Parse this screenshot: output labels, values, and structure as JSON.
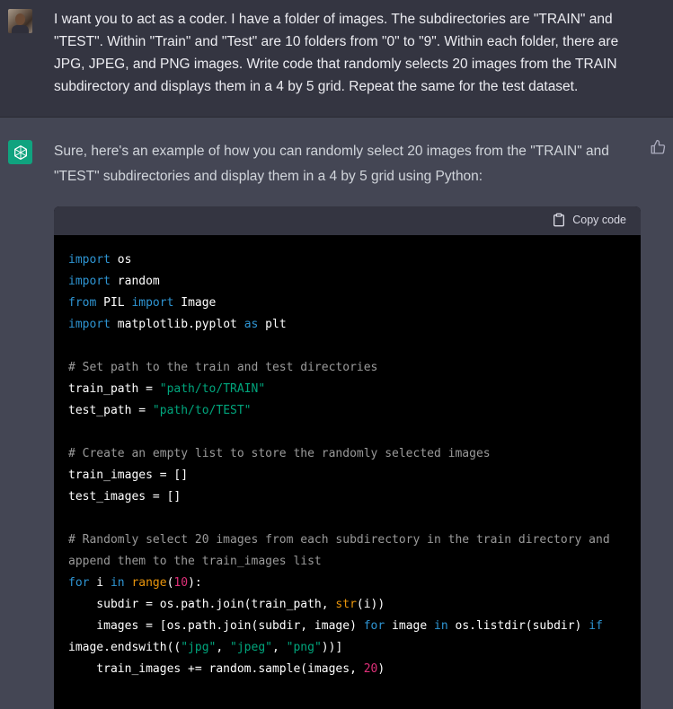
{
  "user_message": {
    "text": "I want you to act as a coder. I have a folder of images. The subdirectories are \"TRAIN\" and \"TEST\". Within \"Train\" and \"Test\" are 10 folders from \"0\" to \"9\". Within each folder, there are JPG, JPEG, and PNG images. Write code that randomly selects 20 images from the TRAIN subdirectory and displays them in a 4 by 5 grid. Repeat the same for the test dataset."
  },
  "assistant_message": {
    "intro": "Sure, here's an example of how you can randomly select 20 images from the \"TRAIN\" and \"TEST\" subdirectories and display them in a 4 by 5 grid using Python:"
  },
  "code_block": {
    "copy_label": "Copy code",
    "lines": {
      "l1": {
        "kw": "import",
        "rest": " os"
      },
      "l2": {
        "kw": "import",
        "rest": " random"
      },
      "l3": {
        "kw1": "from",
        "mid": " PIL ",
        "kw2": "import",
        "rest": " Image"
      },
      "l4": {
        "kw1": "import",
        "mid": " matplotlib.pyplot ",
        "kw2": "as",
        "rest": " plt"
      },
      "l6": {
        "comment": "# Set path to the train and test directories"
      },
      "l7": {
        "pre": "train_path = ",
        "str": "\"path/to/TRAIN\""
      },
      "l8": {
        "pre": "test_path = ",
        "str": "\"path/to/TEST\""
      },
      "l10": {
        "comment": "# Create an empty list to store the randomly selected images"
      },
      "l11": {
        "text": "train_images = []"
      },
      "l12": {
        "text": "test_images = []"
      },
      "l14": {
        "comment": "# Randomly select 20 images from each subdirectory in the train directory and"
      },
      "l15": {
        "comment": "append them to the train_images list"
      },
      "l16": {
        "kw1": "for",
        "mid": " i ",
        "kw2": "in",
        "sp": " ",
        "fn": "range",
        "p1": "(",
        "num": "10",
        "p2": "):"
      },
      "l17": {
        "pre": "    subdir = os.path.join(train_path, ",
        "fn": "str",
        "post": "(i))"
      },
      "l18": {
        "pre": "    images = [os.path.join(subdir, image) ",
        "kw1": "for",
        "mid": " image ",
        "kw2": "in",
        "mid2": " os.listdir(subdir) ",
        "kw3": "if"
      },
      "l19": {
        "pre": "image.endswith((",
        "s1": "\"jpg\"",
        "c1": ", ",
        "s2": "\"jpeg\"",
        "c2": ", ",
        "s3": "\"png\"",
        "post": "))]"
      },
      "l20": {
        "pre": "    train_images += random.sample(images, ",
        "num": "20",
        "post": ")"
      }
    }
  },
  "colors": {
    "user_bg": "#343541",
    "assistant_bg": "#444654",
    "code_bg": "#000000",
    "keyword": "#2e95d3",
    "string": "#00a67d",
    "number": "#df3079",
    "builtin": "#e9950c",
    "comment": "#9a9a9a",
    "brand": "#10a37f"
  },
  "icons": {
    "user_avatar": "user-avatar",
    "assistant_logo": "openai-logo-icon",
    "feedback": "thumbs-up-icon",
    "copy": "clipboard-icon"
  }
}
